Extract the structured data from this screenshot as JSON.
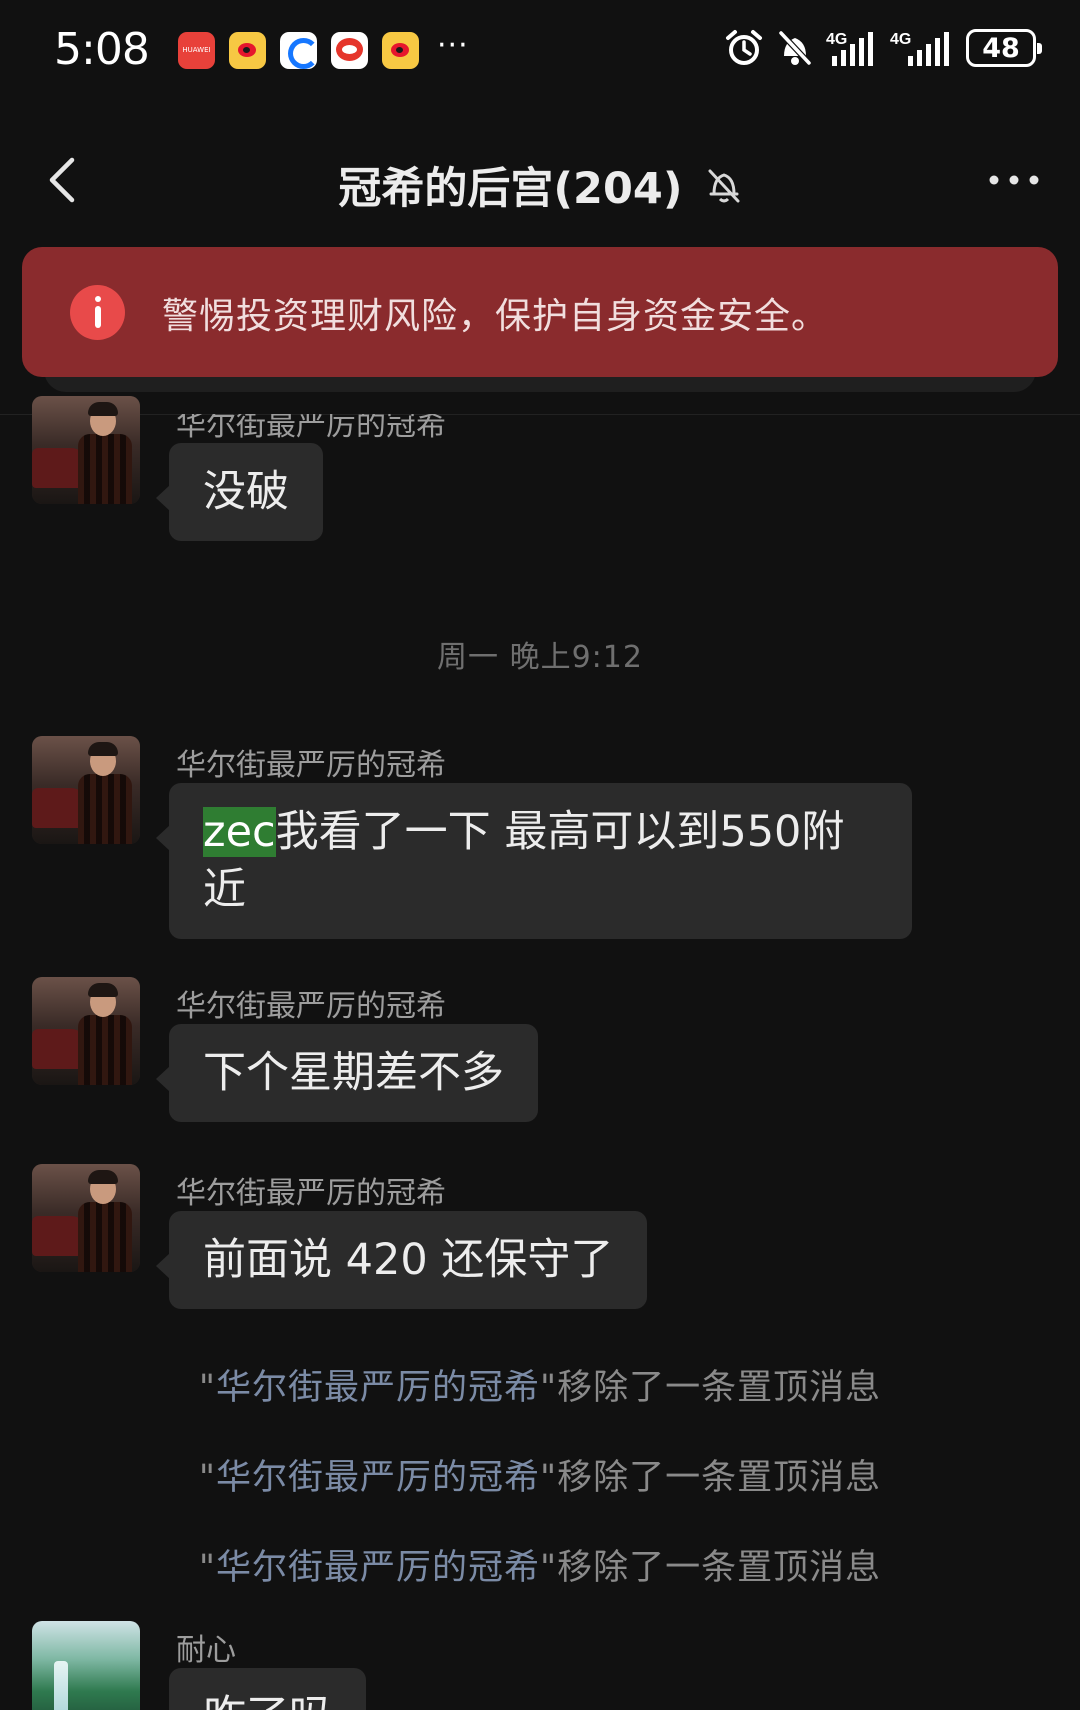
{
  "status_bar": {
    "time": "5:08",
    "huawei_label": "HUAWEI",
    "more": "···",
    "signal_1": "4G",
    "signal_2": "4G",
    "battery": "48"
  },
  "header": {
    "title": "冠希的后宫(204)",
    "icons": [
      "back-chevron-icon",
      "bell-muted-icon",
      "more-dots-icon"
    ]
  },
  "banner": {
    "text": "警惕投资理财风险，保护自身资金安全。",
    "accent": "#8a2b2d"
  },
  "messages": [
    {
      "sender": "华尔街最严厉的冠希",
      "text": "没破"
    },
    {
      "timestamp": "周一 晚上9:12"
    },
    {
      "sender": "华尔街最严厉的冠希",
      "highlight": "zec",
      "text": "我看了一下 最高可以到550附近"
    },
    {
      "sender": "华尔街最严厉的冠希",
      "text": "下个星期差不多"
    },
    {
      "sender": "华尔街最严厉的冠希",
      "text": "前面说 420 还保守了"
    },
    {
      "system_who": "华尔街最严厉的冠希",
      "system_action": "移除了一条置顶消息"
    },
    {
      "system_who": "华尔街最严厉的冠希",
      "system_action": "移除了一条置顶消息"
    },
    {
      "system_who": "华尔街最严厉的冠希",
      "system_action": "移除了一条置顶消息"
    },
    {
      "sender": "耐心",
      "text": "咋了吗"
    }
  ]
}
